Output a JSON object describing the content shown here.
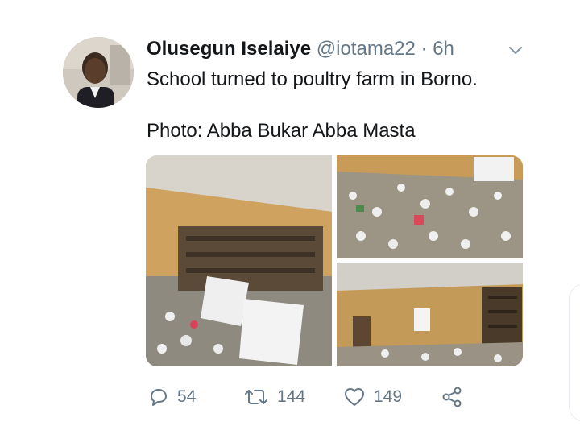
{
  "tweet": {
    "author_name": "Olusegun Iselaiye",
    "handle": "@iotama22",
    "separator": "·",
    "time": "6h",
    "text_line1": "School turned to poultry farm in Borno.",
    "text_line2": "Photo: Abba Bukar Abba Masta"
  },
  "media": [
    {
      "name": "classroom-desks-photo"
    },
    {
      "name": "chickens-floor-photo"
    },
    {
      "name": "room-interior-photo"
    }
  ],
  "actions": {
    "reply_icon": "reply-icon",
    "reply_count": "54",
    "retweet_icon": "retweet-icon",
    "retweet_count": "144",
    "like_icon": "heart-icon",
    "like_count": "149",
    "share_icon": "share-icon"
  },
  "colors": {
    "text": "#14171a",
    "secondary": "#657786"
  }
}
